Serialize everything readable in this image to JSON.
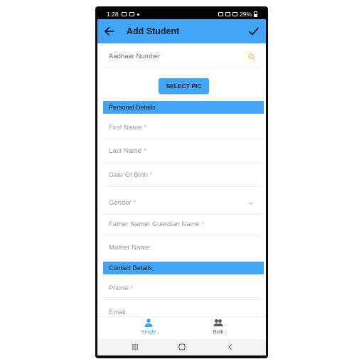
{
  "status": {
    "time": "1:28",
    "battery": "29%"
  },
  "appbar": {
    "title": "Add Student"
  },
  "form": {
    "aadhaar_placeholder": "Aadhaar Number",
    "select_pic_label": "SELECT PIC",
    "personal_header": "Personal Details",
    "first_name": "First Name",
    "last_name": "Last Name",
    "dob": "Date Of Birth",
    "gender": "Gender",
    "father_name": "Father Name/ Guardian Name",
    "mother_name": "Mother Name",
    "contact_header": "Contact Details",
    "phone": "Phone",
    "email": "Email",
    "required_mark": "*"
  },
  "bottom_nav": {
    "single": "Single",
    "bulk": "Bulk"
  },
  "colors": {
    "accent": "#42a5f5",
    "required": "#ef9a9a"
  }
}
